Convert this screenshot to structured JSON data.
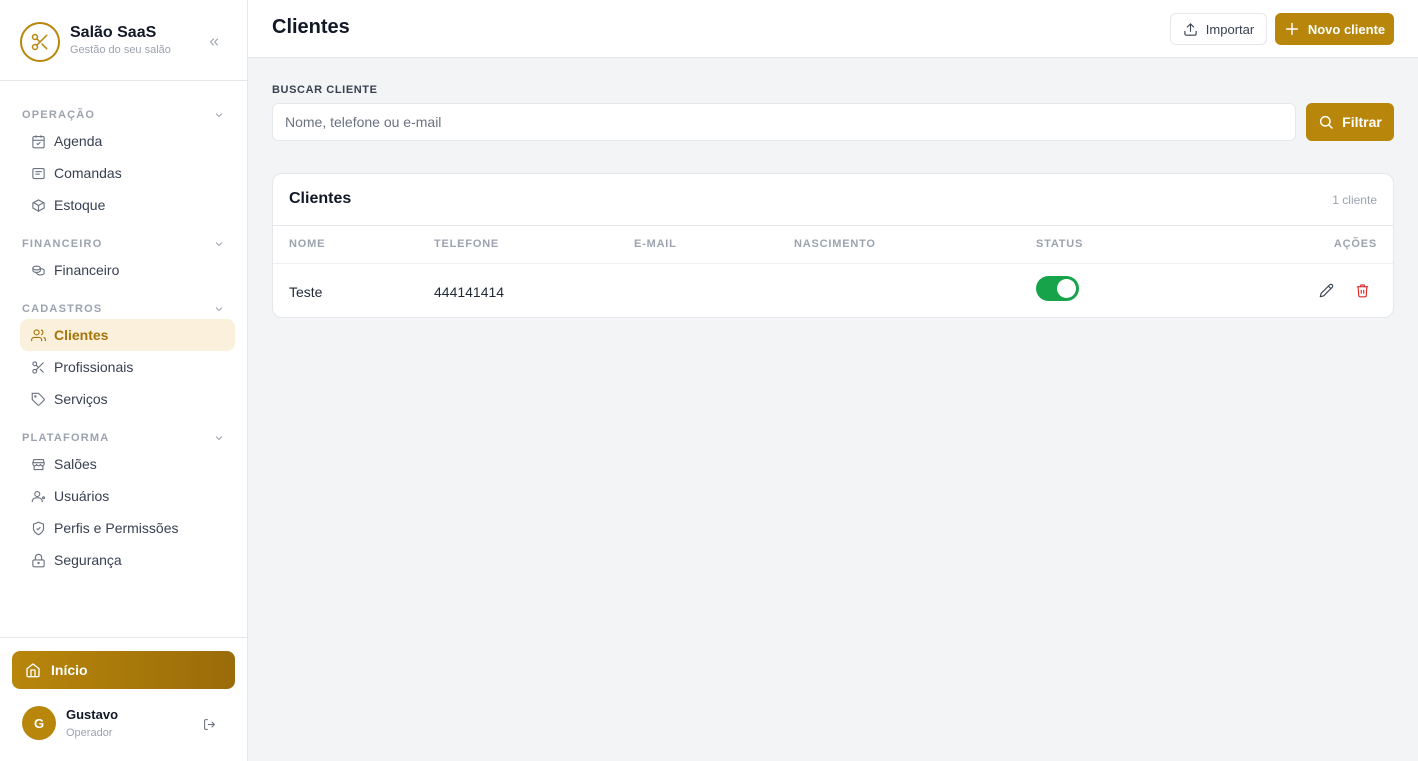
{
  "brand": {
    "name": "Salão SaaS",
    "subtitle": "Gestão do seu salão",
    "icon": "scissors-icon"
  },
  "sidebar": {
    "sections": [
      {
        "title": "OPERAÇÃO",
        "items": [
          {
            "label": "Agenda",
            "icon": "calendar-icon"
          },
          {
            "label": "Comandas",
            "icon": "receipt-icon"
          },
          {
            "label": "Estoque",
            "icon": "box-icon"
          }
        ]
      },
      {
        "title": "FINANCEIRO",
        "items": [
          {
            "label": "Financeiro",
            "icon": "coins-icon"
          }
        ]
      },
      {
        "title": "CADASTROS",
        "items": [
          {
            "label": "Clientes",
            "icon": "users-icon",
            "active": true
          },
          {
            "label": "Profissionais",
            "icon": "scissors-icon"
          },
          {
            "label": "Serviços",
            "icon": "tag-icon"
          }
        ]
      },
      {
        "title": "PLATAFORMA",
        "items": [
          {
            "label": "Salões",
            "icon": "store-icon"
          },
          {
            "label": "Usuários",
            "icon": "user-icon"
          },
          {
            "label": "Perfis e Permissões",
            "icon": "shield-icon"
          },
          {
            "label": "Segurança",
            "icon": "lock-icon"
          }
        ]
      }
    ],
    "home_label": "Início",
    "user": {
      "initial": "G",
      "name": "Gustavo",
      "role": "Operador"
    }
  },
  "header": {
    "title": "Clientes",
    "import_label": "Importar",
    "new_label": "Novo cliente"
  },
  "search": {
    "label": "BUSCAR CLIENTE",
    "placeholder": "Nome, telefone ou e-mail",
    "value": "",
    "filter_label": "Filtrar"
  },
  "table": {
    "title": "Clientes",
    "count": "1 cliente",
    "columns": [
      "NOME",
      "TELEFONE",
      "E-MAIL",
      "NASCIMENTO",
      "STATUS",
      "AÇÕES"
    ],
    "rows": [
      {
        "nome": "Teste",
        "telefone": "444141414",
        "email": "",
        "nascimento": "",
        "status_active": true
      }
    ]
  },
  "colors": {
    "accent": "#b8860b",
    "active_bg": "#fbf0dc",
    "toggle_on": "#16a34a",
    "danger": "#dc2626"
  }
}
